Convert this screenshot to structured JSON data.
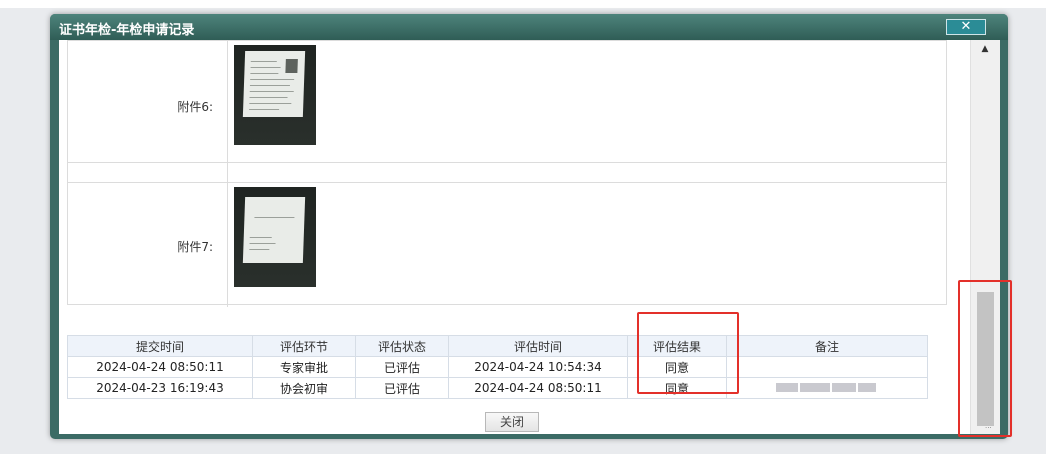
{
  "dialog": {
    "title": "证书年检-年检申请记录",
    "close_icon": "✕"
  },
  "attachments": [
    {
      "label": "附件6:",
      "thumbnail": "document-scan-with-photo"
    },
    {
      "label": "附件7:",
      "thumbnail": "document-scan-text"
    }
  ],
  "log_table": {
    "headers": [
      "提交时间",
      "评估环节",
      "评估状态",
      "评估时间",
      "评估结果",
      "备注"
    ],
    "rows": [
      [
        "2024-04-24 08:50:11",
        "专家审批",
        "已评估",
        "2024-04-24 10:54:34",
        "同意",
        ""
      ],
      [
        "2024-04-23 16:19:43",
        "协会初审",
        "已评估",
        "2024-04-24 08:50:11",
        "同意",
        ""
      ]
    ]
  },
  "footer": {
    "close_label": "关闭"
  },
  "scrollbar": {
    "up_arrow": "▲",
    "grip": "...",
    "position": 0.95
  },
  "colors": {
    "titlebar": "#3b6b65",
    "highlight": "#e3302a",
    "header_bg": "#eef3fa"
  }
}
